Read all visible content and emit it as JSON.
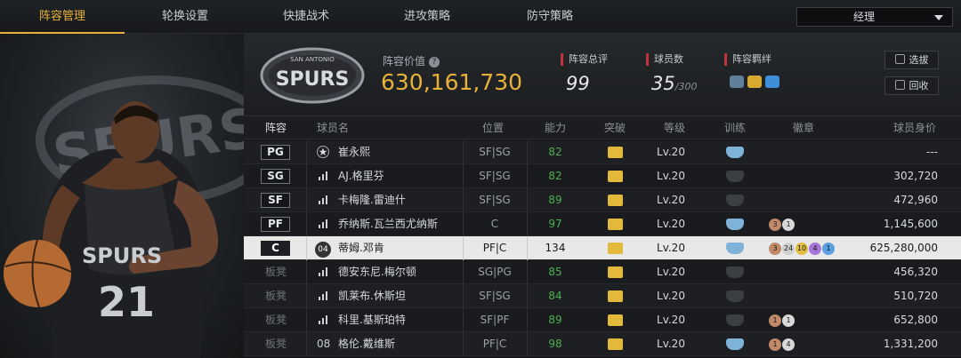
{
  "tabs": [
    {
      "label": "阵容管理",
      "active": true
    },
    {
      "label": "轮换设置"
    },
    {
      "label": "快捷战术"
    },
    {
      "label": "进攻策略"
    },
    {
      "label": "防守策略"
    }
  ],
  "dropdown": {
    "value": "经理"
  },
  "team": {
    "logo_text": "SPURS",
    "logo_top": "SAN ANTONIO",
    "value_label": "阵容价值",
    "value": "630,161,730",
    "stats": [
      {
        "label": "阵容总评",
        "value": "99",
        "suffix": ""
      },
      {
        "label": "球员数",
        "value": "35",
        "suffix": "/300"
      },
      {
        "label": "阵容羁绊",
        "value": "",
        "suffix": ""
      }
    ],
    "buttons": [
      {
        "label": "选拔",
        "icon": "refresh-icon"
      },
      {
        "label": "回收",
        "icon": "recycle-icon"
      }
    ]
  },
  "columns": [
    "阵容",
    "球员名",
    "位置",
    "能力",
    "突破",
    "等级",
    "训练",
    "徽章",
    "球员身价"
  ],
  "players": [
    {
      "slot": "PG",
      "starter": true,
      "num_icon": "star-icon",
      "name": "崔永熙",
      "pos": "SF|SG",
      "ability": "82",
      "level": "Lv.20",
      "train": "blue",
      "badges": [],
      "price": "---"
    },
    {
      "slot": "SG",
      "starter": true,
      "num_icon": "signal-icon",
      "name": "AJ.格里芬",
      "pos": "SF|SG",
      "ability": "82",
      "level": "Lv.20",
      "train": "dark",
      "badges": [],
      "price": "302,720"
    },
    {
      "slot": "SF",
      "starter": true,
      "num_icon": "signal-icon",
      "name": "卡梅隆.雷迪什",
      "pos": "SF|SG",
      "ability": "89",
      "level": "Lv.20",
      "train": "dark",
      "badges": [],
      "price": "472,960"
    },
    {
      "slot": "PF",
      "starter": true,
      "num_icon": "signal-icon",
      "name": "乔纳斯.瓦兰西尤纳斯",
      "pos": "C",
      "ability": "97",
      "level": "Lv.20",
      "train": "blue",
      "badges": [
        {
          "t": "3",
          "c": "#c08a6a"
        },
        {
          "t": "1",
          "c": "#d8d8d8"
        }
      ],
      "price": "1,145,600"
    },
    {
      "slot": "C",
      "starter": true,
      "selected": true,
      "num_icon": "jersey-icon",
      "num_text": "04",
      "name": "蒂姆.邓肯",
      "pos": "PF|C",
      "ability": "134",
      "level": "Lv.20",
      "train": "blue",
      "badges": [
        {
          "t": "3",
          "c": "#c08a6a"
        },
        {
          "t": "24",
          "c": "#cfcfcf"
        },
        {
          "t": "10",
          "c": "#e2bf43"
        },
        {
          "t": "4",
          "c": "#a774d8"
        },
        {
          "t": "1",
          "c": "#5aa0e0"
        }
      ],
      "price": "625,280,000"
    },
    {
      "slot": "板凳",
      "starter": false,
      "num_icon": "signal-icon",
      "name": "德安东尼.梅尔顿",
      "pos": "SG|PG",
      "ability": "85",
      "level": "Lv.20",
      "train": "dark",
      "badges": [],
      "price": "456,320"
    },
    {
      "slot": "板凳",
      "starter": false,
      "num_icon": "signal-icon",
      "name": "凯莱布.休斯坦",
      "pos": "SF|SG",
      "ability": "84",
      "level": "Lv.20",
      "train": "dark",
      "badges": [],
      "price": "510,720"
    },
    {
      "slot": "板凳",
      "starter": false,
      "num_icon": "signal-icon",
      "name": "科里.基斯珀特",
      "pos": "SF|PF",
      "ability": "89",
      "level": "Lv.20",
      "train": "dark",
      "badges": [
        {
          "t": "1",
          "c": "#c08a6a"
        },
        {
          "t": "1",
          "c": "#d8d8d8"
        }
      ],
      "price": "652,800"
    },
    {
      "slot": "板凳",
      "starter": false,
      "num_icon": "number",
      "num_text": "08",
      "name": "格伦.戴维斯",
      "pos": "PF|C",
      "ability": "98",
      "level": "Lv.20",
      "train": "blue",
      "badges": [
        {
          "t": "1",
          "c": "#c08a6a"
        },
        {
          "t": "4",
          "c": "#d8d8d8"
        }
      ],
      "price": "1,331,200"
    }
  ],
  "hero": {
    "jersey_text": "SPURS",
    "jersey_number": "21"
  },
  "colors": {
    "accent": "#e8b23a",
    "ability_green": "#4caf50",
    "red_marker": "#c0333a",
    "train_blue": "#7fb2d8"
  }
}
